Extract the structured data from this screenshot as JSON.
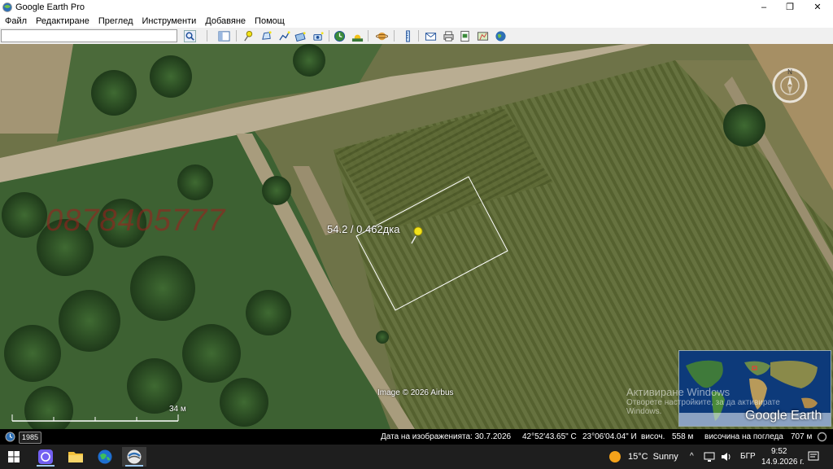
{
  "window": {
    "title": "Google Earth Pro",
    "minimize": "–",
    "maximize": "❐",
    "close": "✕"
  },
  "menu": [
    "Файл",
    "Редактиране",
    "Преглед",
    "Инструменти",
    "Добавяне",
    "Помощ"
  ],
  "search": {
    "value": "",
    "placeholder": ""
  },
  "map": {
    "placemark_label": "54.2 / 0.462дка",
    "watermark": "0878405777",
    "attribution": "Image © 2026 Airbus",
    "scale_label": "34 м",
    "compass_label": "N",
    "activation_title": "Активиране Windows",
    "activation_sub": "Отворете настройките, за да активирате Windows.",
    "logo": "Google Earth"
  },
  "status": {
    "year_badge": "1985",
    "image_date": "Дата на изображенията: 30.7.2026",
    "lat": "42°52'43.65\" С",
    "lon": "23°06'04.04\" И",
    "elev_label": "височ.",
    "elev_value": "558 м",
    "eye_label": "височина на погледа",
    "eye_value": "707 м"
  },
  "taskbar": {
    "weather_temp": "15°C",
    "weather_text": "Sunny",
    "caret": "^",
    "lang": "БГР",
    "time": "9:52",
    "date": "14.9.2026 г."
  },
  "colors": {
    "placemark": "#f2e21a",
    "polygon": "#ffffff",
    "field": "#5d6b3a",
    "forest": "#2c4a23",
    "road": "#b9ad92"
  }
}
